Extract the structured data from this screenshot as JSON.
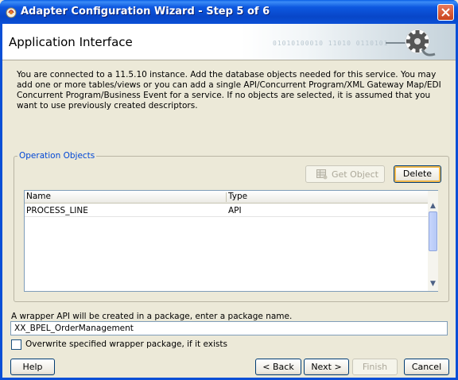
{
  "window": {
    "title": "Adapter Configuration Wizard - Step 5 of 6",
    "close_label": "Close"
  },
  "banner": {
    "title": "Application Interface",
    "art_bits": "01010100010 11010 0110101"
  },
  "intro": {
    "text": "You are connected to a 11.5.10 instance. Add the database objects needed for this service. You may add one or more tables/views or you can add a single API/Concurrent Program/XML Gateway Map/EDI Concurrent Program/Business Event for a service. If no objects are selected, it is assumed that you want to use previously created descriptors."
  },
  "operation_objects": {
    "legend": "Operation Objects",
    "get_object_label": "Get Object",
    "delete_label": "Delete",
    "columns": [
      "Name",
      "Type"
    ],
    "rows": [
      {
        "name": "PROCESS_LINE",
        "type": "API"
      }
    ]
  },
  "package": {
    "label": "A wrapper API will be created in a package, enter a package name.",
    "value": "XX_BPEL_OrderManagement",
    "overwrite_label": "Overwrite specified wrapper package, if it exists",
    "overwrite_checked": false
  },
  "footer": {
    "help_label": "Help",
    "back_label": "< Back",
    "next_label": "Next >",
    "finish_label": "Finish",
    "cancel_label": "Cancel"
  }
}
